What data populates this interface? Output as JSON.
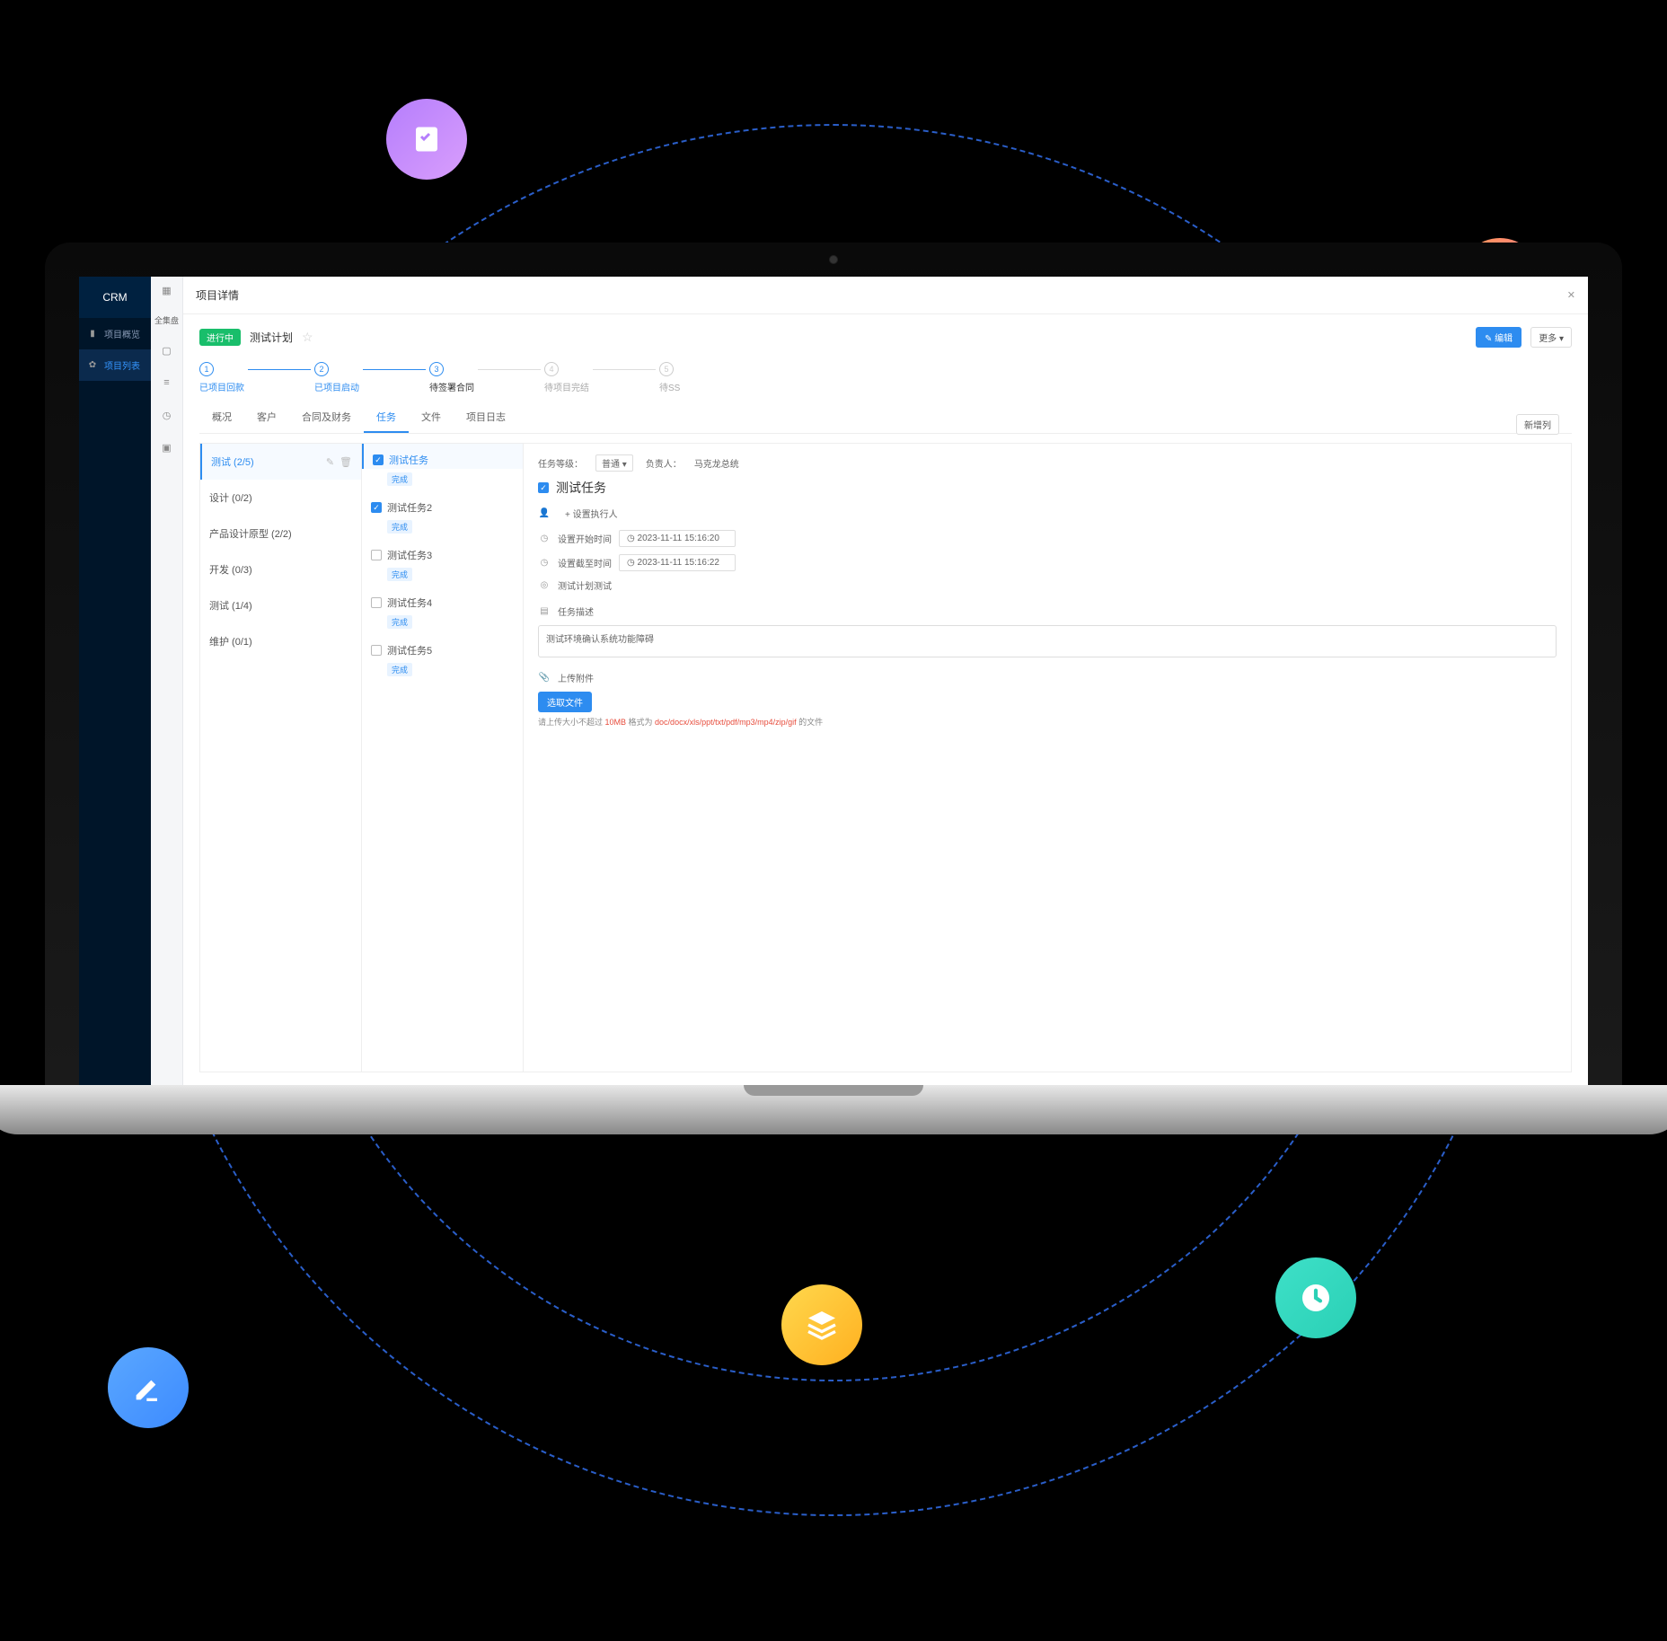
{
  "floatIcons": {
    "checklist": "checklist",
    "notes": "notes",
    "pencil": "pencil",
    "stack": "stack",
    "clock": "clock"
  },
  "sidebar": {
    "brand": "CRM",
    "items": [
      {
        "label": "项目概览",
        "icon": "chart"
      },
      {
        "label": "项目列表",
        "icon": "setting",
        "active": true
      }
    ],
    "col2tabs": [
      "全集盘",
      "",
      ""
    ]
  },
  "secondaryIcons": [
    "grid",
    "file",
    "list",
    "clock",
    "folder"
  ],
  "header": {
    "title": "项目详情"
  },
  "project": {
    "statusBadge": "进行中",
    "name": "测试计划",
    "editBtn": "✎ 编辑",
    "moreBtn": "更多 ▾"
  },
  "steps": [
    {
      "num": "1",
      "label": "已项目回款",
      "state": "done"
    },
    {
      "num": "2",
      "label": "已项目启动",
      "state": "done"
    },
    {
      "num": "3",
      "label": "待签署合同",
      "state": "current"
    },
    {
      "num": "4",
      "label": "待项目完结",
      "state": "inactive"
    },
    {
      "num": "5",
      "label": "待SS",
      "state": "inactive"
    }
  ],
  "tabs": [
    "概况",
    "客户",
    "合同及财务",
    "任务",
    "文件",
    "项目日志"
  ],
  "activeTab": "任务",
  "newColBtn": "新增列",
  "categories": [
    {
      "label": "测试  (2/5)",
      "active": true,
      "editable": true
    },
    {
      "label": "设计  (0/2)"
    },
    {
      "label": "产品设计原型  (2/2)"
    },
    {
      "label": "开发  (0/3)"
    },
    {
      "label": "测试  (1/4)"
    },
    {
      "label": "维护  (0/1)"
    }
  ],
  "tasks": [
    {
      "label": "测试任务",
      "checked": true,
      "active": true,
      "tag": "完成"
    },
    {
      "label": "测试任务2",
      "checked": true,
      "tag": "完成"
    },
    {
      "label": "测试任务3",
      "checked": false,
      "tag": "完成"
    },
    {
      "label": "测试任务4",
      "checked": false,
      "tag": "完成"
    },
    {
      "label": "测试任务5",
      "checked": false,
      "tag": "完成"
    }
  ],
  "detail": {
    "priorityLabel": "任务等级：",
    "priorityValue": "普通",
    "ownerLabel": "负责人：",
    "ownerValue": "马克龙总统",
    "title": "测试任务",
    "assignPlaceholder": "+ 设置执行人",
    "startLabel": "设置开始时间",
    "startValue": "2023-11-11 15:16:20",
    "endLabel": "设置截至时间",
    "endValue": "2023-11-11 15:16:22",
    "planLabel": "测试计划测试",
    "descLabel": "任务描述",
    "descValue": "测试环境确认系统功能障碍",
    "attachLabel": "上传附件",
    "selectFileBtn": "选取文件",
    "uploadHint1": "请上传大小不超过 ",
    "uploadHintRed": "10MB",
    "uploadHint2": " 格式为 ",
    "uploadHintRed2": "doc/docx/xls/ppt/txt/pdf/mp3/mp4/zip/gif",
    "uploadHint3": " 的文件"
  }
}
